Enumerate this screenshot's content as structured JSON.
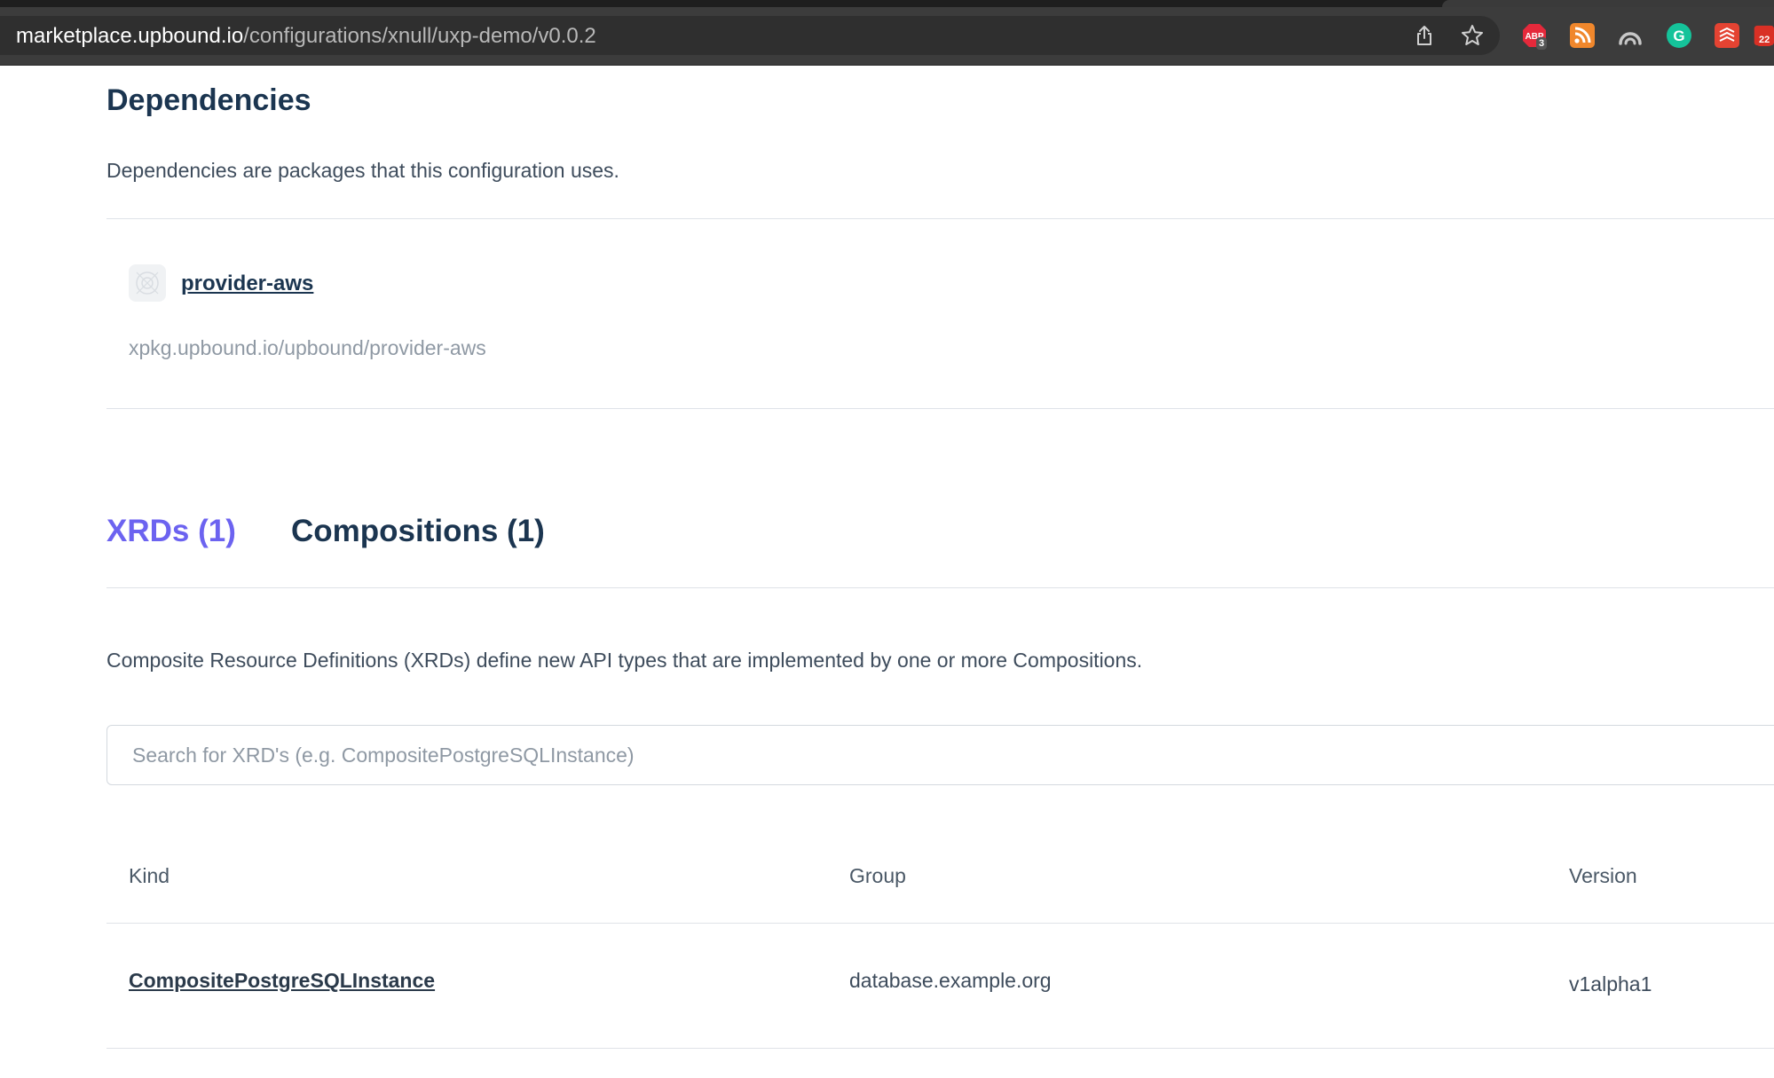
{
  "browser": {
    "url_host": "marketplace.upbound.io",
    "url_path": "/configurations/xnull/uxp-demo/v0.0.2",
    "extensions": [
      {
        "icon": "adblock-icon",
        "badge": "3"
      },
      {
        "icon": "rss-icon"
      },
      {
        "icon": "arc-icon"
      },
      {
        "icon": "grammarly-icon"
      },
      {
        "icon": "todoist-icon"
      },
      {
        "icon": "calendar-icon",
        "badge": "22"
      }
    ]
  },
  "dependencies": {
    "title": "Dependencies",
    "description": "Dependencies are packages that this configuration uses.",
    "items": [
      {
        "name": "provider-aws",
        "path": "xpkg.upbound.io/upbound/provider-aws"
      }
    ]
  },
  "tabs": [
    {
      "label": "XRDs (1)",
      "active": true
    },
    {
      "label": "Compositions (1)",
      "active": false
    }
  ],
  "xrds": {
    "description": "Composite Resource Definitions (XRDs) define new API types that are implemented by one or more Compositions.",
    "search_placeholder": "Search for XRD's (e.g. CompositePostgreSQLInstance)",
    "columns": [
      "Kind",
      "Group",
      "Version"
    ],
    "rows": [
      {
        "kind": "CompositePostgreSQLInstance",
        "group": "database.example.org",
        "version": "v1alpha1"
      }
    ]
  },
  "colors": {
    "accent": "#6c63f0",
    "heading": "#1b3550",
    "chrome": "#3c3c3c"
  }
}
